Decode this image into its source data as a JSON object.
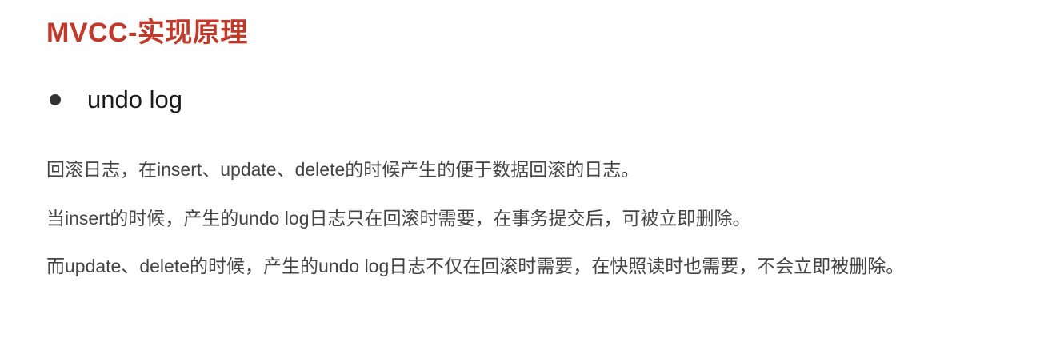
{
  "slide": {
    "title": "MVCC-实现原理",
    "title_color": "#c0392b",
    "bullet": {
      "icon": "bullet-dot-icon",
      "text": "undo log"
    },
    "paragraphs": [
      "回滚日志，在insert、update、delete的时候产生的便于数据回滚的日志。",
      "当insert的时候，产生的undo log日志只在回滚时需要，在事务提交后，可被立即删除。",
      "而update、delete的时候，产生的undo log日志不仅在回滚时需要，在快照读时也需要，不会立即被删除。"
    ]
  }
}
